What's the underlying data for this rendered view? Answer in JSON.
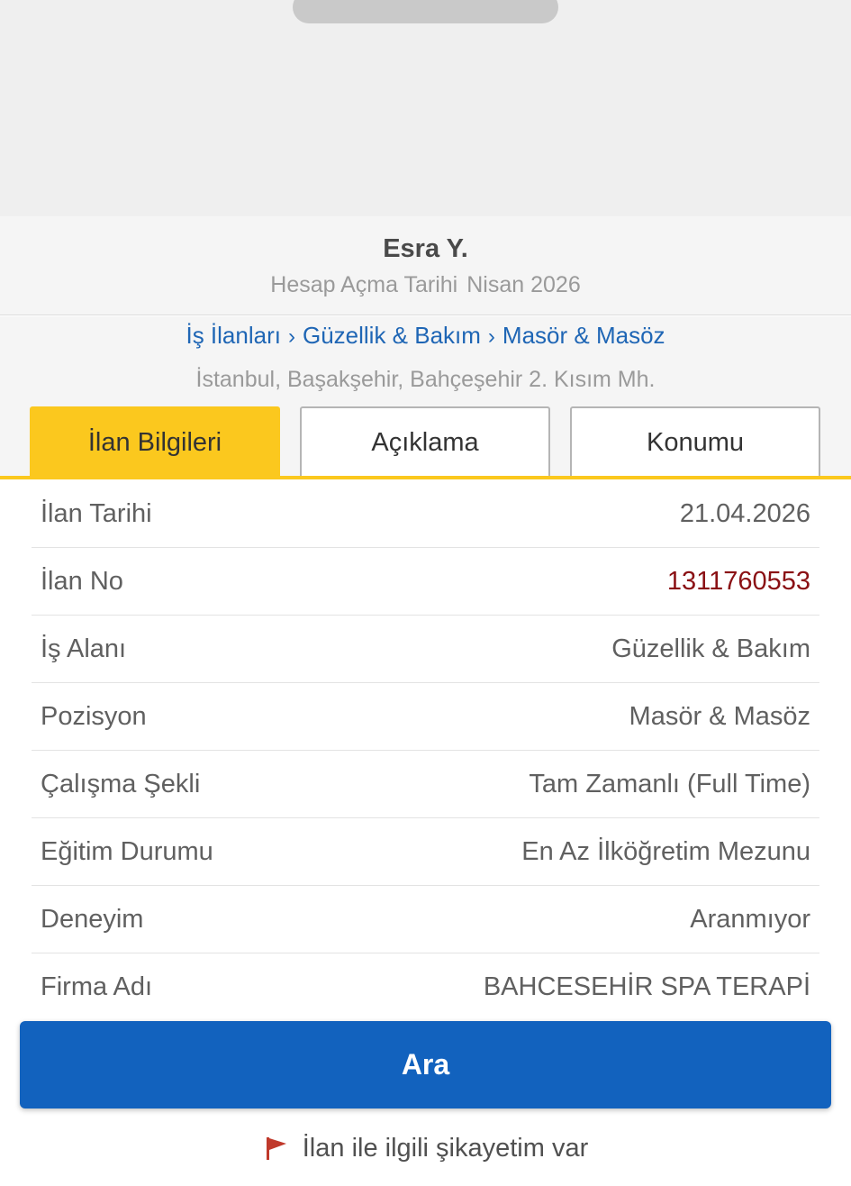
{
  "seller": {
    "name": "Esra Y.",
    "since_label": "Hesap Açma Tarihi",
    "since_value": "Nisan 2026"
  },
  "breadcrumb": {
    "items": [
      "İş İlanları",
      "Güzellik & Bakım",
      "Masör & Masöz"
    ],
    "separator": "›"
  },
  "location": "İstanbul, Başakşehir, Bahçeşehir 2. Kısım Mh.",
  "tabs": [
    {
      "label": "İlan Bilgileri",
      "active": true
    },
    {
      "label": "Açıklama",
      "active": false
    },
    {
      "label": "Konumu",
      "active": false
    }
  ],
  "details": [
    {
      "key": "İlan Tarihi",
      "value": "21.04.2026"
    },
    {
      "key": "İlan No",
      "value": "1311760553"
    },
    {
      "key": "İş Alanı",
      "value": "Güzellik & Bakım"
    },
    {
      "key": "Pozisyon",
      "value": "Masör & Masöz"
    },
    {
      "key": "Çalışma Şekli",
      "value": "Tam Zamanlı (Full Time)"
    },
    {
      "key": "Eğitim Durumu",
      "value": "En Az İlköğretim Mezunu"
    },
    {
      "key": "Deneyim",
      "value": "Aranmıyor"
    },
    {
      "key": "Firma Adı",
      "value": "BAHCESEHİR SPA TERAPİ"
    }
  ],
  "call_button": "Ara",
  "report_link": "İlan ile ilgili şikayetim var",
  "colors": {
    "accent_yellow": "#fbc81e",
    "primary_blue": "#1262be",
    "link_blue": "#1f66b5",
    "id_red": "#8a1014",
    "flag_red": "#c0392b"
  },
  "icons": {
    "report": "flag-icon"
  }
}
